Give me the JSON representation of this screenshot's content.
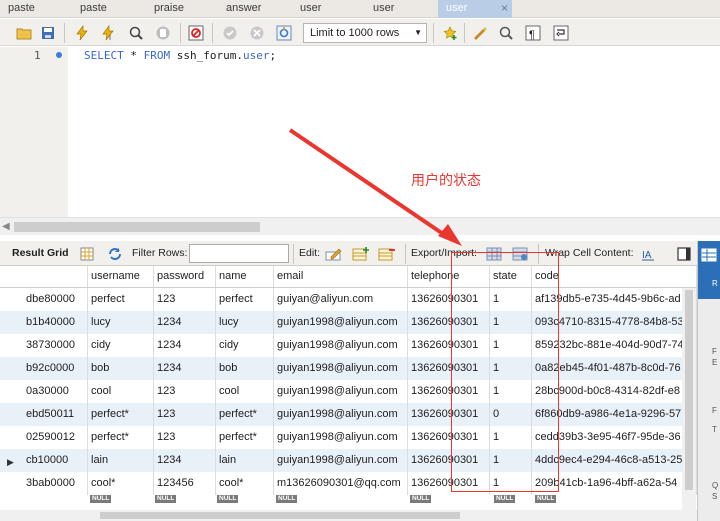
{
  "tabs": [
    {
      "label": "paste"
    },
    {
      "label": "paste"
    },
    {
      "label": "praise"
    },
    {
      "label": "answer"
    },
    {
      "label": "user"
    },
    {
      "label": "user"
    },
    {
      "label": "user",
      "active": true,
      "close": "×"
    }
  ],
  "toolbar": {
    "limit_label": "Limit to 1000 rows"
  },
  "editor": {
    "line_number": "1",
    "sql": {
      "kw1": "SELECT",
      "star": " * ",
      "kw2": "FROM",
      "schema": " ssh_forum.",
      "table": "user",
      "end": ";"
    }
  },
  "annotation": "用户的状态",
  "result_toolbar": {
    "result_grid": "Result Grid",
    "filter_rows": "Filter Rows:",
    "filter_value": "",
    "edit": "Edit:",
    "export_import": "Export/Import:",
    "wrap_cell": "Wrap Cell Content:"
  },
  "grid": {
    "columns": [
      "",
      "username",
      "password",
      "name",
      "email",
      "telephone",
      "state",
      "code"
    ],
    "rows": [
      [
        "dbe80000",
        "perfect",
        "123",
        "perfect",
        "guiyan@aliyun.com",
        "13626090301",
        "1",
        "af139db5-e735-4d45-9b6c-ad"
      ],
      [
        "b1b40000",
        "lucy",
        "1234",
        "lucy",
        "guiyan1998@aliyun.com",
        "13626090301",
        "1",
        "093c4710-8315-4778-84b8-53"
      ],
      [
        "38730000",
        "cidy",
        "1234",
        "cidy",
        "guiyan1998@aliyun.com",
        "13626090301",
        "1",
        "859232bc-881e-404d-90d7-74"
      ],
      [
        "b92c0000",
        "bob",
        "1234",
        "bob",
        "guiyan1998@aliyun.com",
        "13626090301",
        "1",
        "0a82eb45-4f01-487b-8c0d-76"
      ],
      [
        "0a30000",
        "cool",
        "123",
        "cool",
        "guiyan1998@aliyun.com",
        "13626090301",
        "1",
        "28bc900d-b0c8-4314-82df-e8"
      ],
      [
        "ebd50011",
        "perfect*",
        "123",
        "perfect*",
        "guiyan1998@aliyun.com",
        "13626090301",
        "0",
        "6f860db9-a986-4e1a-9296-57"
      ],
      [
        "02590012",
        "perfect*",
        "123",
        "perfect*",
        "guiyan1998@aliyun.com",
        "13626090301",
        "1",
        "cedd39b3-3e95-46f7-95de-36"
      ],
      [
        "cb10000",
        "lain",
        "1234",
        "lain",
        "guiyan1998@aliyun.com",
        "13626090301",
        "1",
        "4ddc9ec4-e294-46c8-a513-25"
      ],
      [
        "3bab0000",
        "cool*",
        "123456",
        "cool*",
        "m13626090301@qq.com",
        "13626090301",
        "1",
        "209b41cb-1a96-4bff-a62a-54"
      ]
    ],
    "null_label": "NULL"
  },
  "side_panel": {
    "chars": [
      "R",
      "F",
      "E",
      "F",
      "T",
      "Q",
      "S"
    ]
  },
  "colors": {
    "annotation": "#e9362f",
    "alt_row": "#e8f0f8",
    "sql_keyword": "#3a67c9"
  }
}
